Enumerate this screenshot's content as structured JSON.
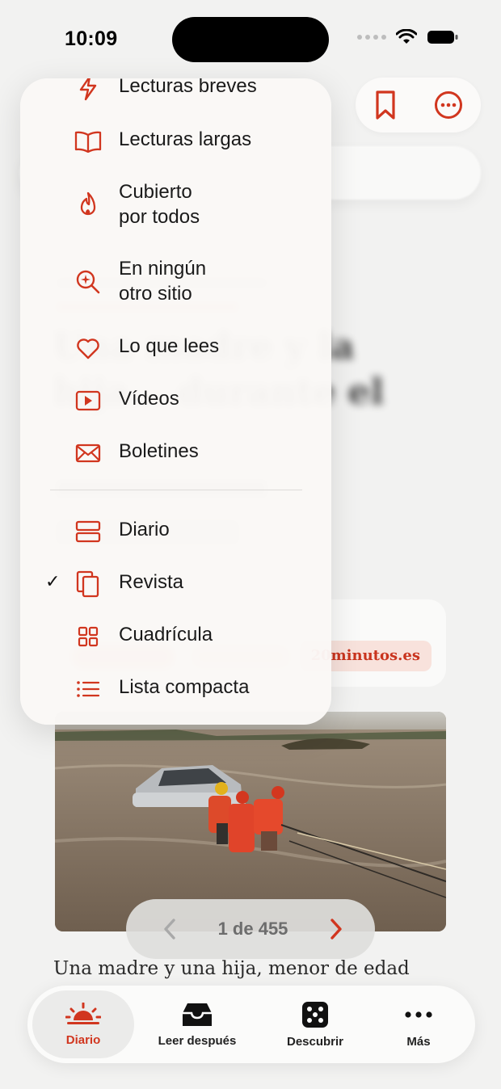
{
  "status_bar": {
    "time": "10:09"
  },
  "menu": {
    "items": [
      {
        "label": "Lecturas breves",
        "icon": "bolt-icon"
      },
      {
        "label": "Lecturas largas",
        "icon": "open-book-icon"
      },
      {
        "label": "Cubierto\npor todos",
        "icon": "flame-icon"
      },
      {
        "label": "En ningún\notro sitio",
        "icon": "sparkle-search-icon"
      },
      {
        "label": "Lo que lees",
        "icon": "heart-icon"
      },
      {
        "label": "Vídeos",
        "icon": "video-play-icon"
      },
      {
        "label": "Boletines",
        "icon": "envelope-icon"
      }
    ],
    "layouts": [
      {
        "label": "Diario",
        "icon": "rows-layout-icon",
        "selected": false
      },
      {
        "label": "Revista",
        "icon": "stacked-pages-icon",
        "selected": true
      },
      {
        "label": "Cuadrícula",
        "icon": "grid-icon",
        "selected": false
      },
      {
        "label": "Lista compacta",
        "icon": "list-icon",
        "selected": false
      }
    ],
    "checkmark": "✓"
  },
  "article": {
    "title_visible_fragment": "Una madre y la hija... durante el",
    "source": "20minutos.es",
    "snippet": "Una madre y una hija, menor de edad"
  },
  "pager": {
    "text": "1 de 455"
  },
  "tabbar": {
    "tabs": [
      {
        "label": "Diario",
        "icon": "sunrise-icon",
        "active": true
      },
      {
        "label": "Leer después",
        "icon": "inbox-tray-icon",
        "active": false
      },
      {
        "label": "Descubrir",
        "icon": "dice-icon",
        "active": false
      },
      {
        "label": "Más",
        "icon": "more-dots-icon",
        "active": false
      }
    ]
  },
  "colors": {
    "accent": "#d1361f",
    "background": "#f2f2f1"
  }
}
